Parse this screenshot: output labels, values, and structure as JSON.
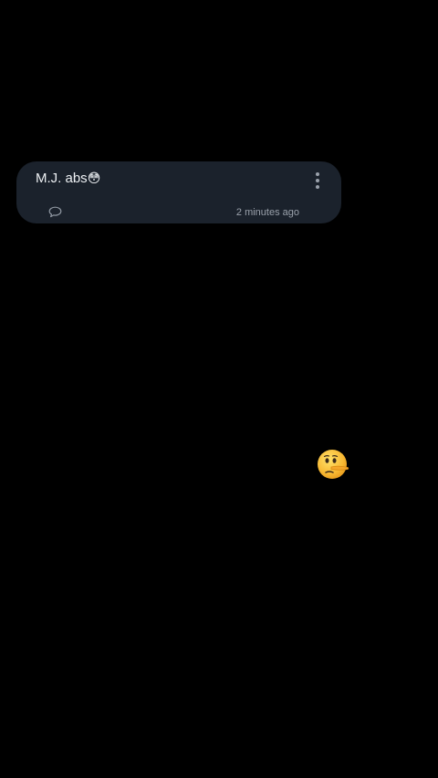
{
  "comment": {
    "text": "M.J. abs",
    "emoji": "😳",
    "timestamp": "2 minutes ago",
    "icons": {
      "reply": "speech-bubble-icon",
      "more": "more-vertical-icon"
    }
  },
  "floating_reaction": {
    "emoji": "🤥",
    "icon": "lying-face-emoji"
  },
  "colors": {
    "background": "#000000",
    "card": "#1b222c",
    "text": "#eef1f4",
    "muted": "#9aa1ab"
  }
}
